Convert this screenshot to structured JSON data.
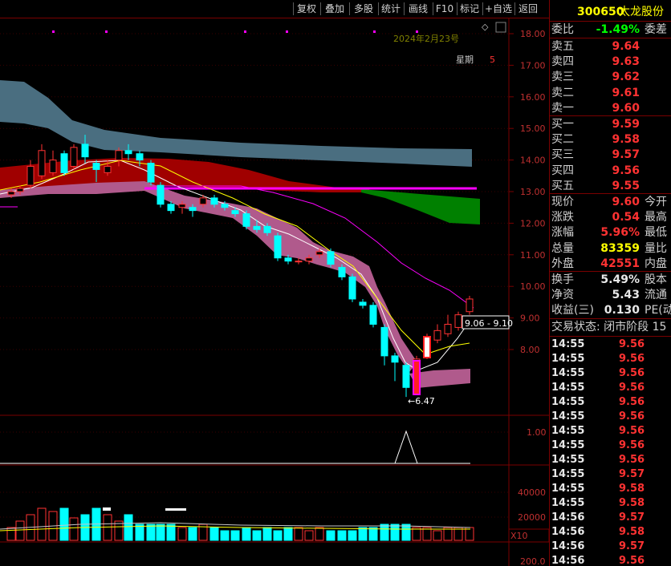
{
  "toolbar": {
    "buttons": [
      "复权",
      "叠加",
      "多股",
      "统计",
      "画线",
      "F10",
      "标记",
      "+自选",
      "返回"
    ]
  },
  "chart_header": {
    "date": "2024年2月23号",
    "weekday_label": "星期",
    "weekday_value": "5",
    "diamond": "◇"
  },
  "price_axis": [
    "18.00",
    "17.00",
    "16.00",
    "15.00",
    "14.00",
    "13.00",
    "12.00",
    "11.00",
    "10.00",
    "9.00",
    "8.00"
  ],
  "indicator_axis": [
    "1.00"
  ],
  "volume_axis": [
    "40000",
    "20000"
  ],
  "volume_unit": "X10",
  "volume_bottom": "200.0",
  "annotations": {
    "low_price": "6.47",
    "range_box": "9.06 - 9.10"
  },
  "colors": {
    "up": "#ff3232",
    "down": "#00ffff",
    "ma_white": "#ffffff",
    "ma_yellow": "#ffff00",
    "ma_magenta": "#ff00ff",
    "band_blue": "#4a6e80",
    "band_red": "#a00000",
    "band_green": "#008000",
    "band_pink": "#b05a8c"
  },
  "quote": {
    "code": "300650",
    "name": "太龙股份",
    "webi_label": "委比",
    "webi_value": "-1.49%",
    "webi_right": "委差",
    "asks": [
      {
        "label": "卖五",
        "price": "9.64"
      },
      {
        "label": "卖四",
        "price": "9.63"
      },
      {
        "label": "卖三",
        "price": "9.62"
      },
      {
        "label": "卖二",
        "price": "9.61"
      },
      {
        "label": "卖一",
        "price": "9.60"
      }
    ],
    "bids": [
      {
        "label": "买一",
        "price": "9.59"
      },
      {
        "label": "买二",
        "price": "9.58"
      },
      {
        "label": "买三",
        "price": "9.57"
      },
      {
        "label": "买四",
        "price": "9.56"
      },
      {
        "label": "买五",
        "price": "9.55"
      }
    ],
    "stats1": [
      {
        "label": "现价",
        "value": "9.60",
        "right": "今开",
        "color": "#ff3232"
      },
      {
        "label": "涨跌",
        "value": "0.54",
        "right": "最高",
        "color": "#ff3232"
      },
      {
        "label": "涨幅",
        "value": "5.96%",
        "right": "最低",
        "color": "#ff3232"
      },
      {
        "label": "总量",
        "value": "83359",
        "right": "量比",
        "color": "#ffff00"
      },
      {
        "label": "外盘",
        "value": "42551",
        "right": "内盘",
        "color": "#ff3232"
      }
    ],
    "stats2": [
      {
        "label": "换手",
        "value": "5.49%",
        "right": "股本",
        "color": "#e8e8e8"
      },
      {
        "label": "净资",
        "value": "5.43",
        "right": "流通",
        "color": "#e8e8e8"
      },
      {
        "label": "收益(三)",
        "value": "0.130",
        "right": "PE(动",
        "color": "#e8e8e8"
      }
    ],
    "trade_status": "交易状态: 闭市阶段 15",
    "ticks": [
      {
        "time": "14:55",
        "price": "9.56"
      },
      {
        "time": "14:55",
        "price": "9.56"
      },
      {
        "time": "14:55",
        "price": "9.56"
      },
      {
        "time": "14:55",
        "price": "9.56"
      },
      {
        "time": "14:55",
        "price": "9.56"
      },
      {
        "time": "14:55",
        "price": "9.56"
      },
      {
        "time": "14:55",
        "price": "9.56"
      },
      {
        "time": "14:55",
        "price": "9.56"
      },
      {
        "time": "14:55",
        "price": "9.56"
      },
      {
        "time": "14:55",
        "price": "9.57"
      },
      {
        "time": "14:55",
        "price": "9.58"
      },
      {
        "time": "14:55",
        "price": "9.58"
      },
      {
        "time": "14:56",
        "price": "9.57"
      },
      {
        "time": "14:56",
        "price": "9.58"
      },
      {
        "time": "14:56",
        "price": "9.57"
      },
      {
        "time": "14:56",
        "price": "9.56"
      }
    ]
  }
}
